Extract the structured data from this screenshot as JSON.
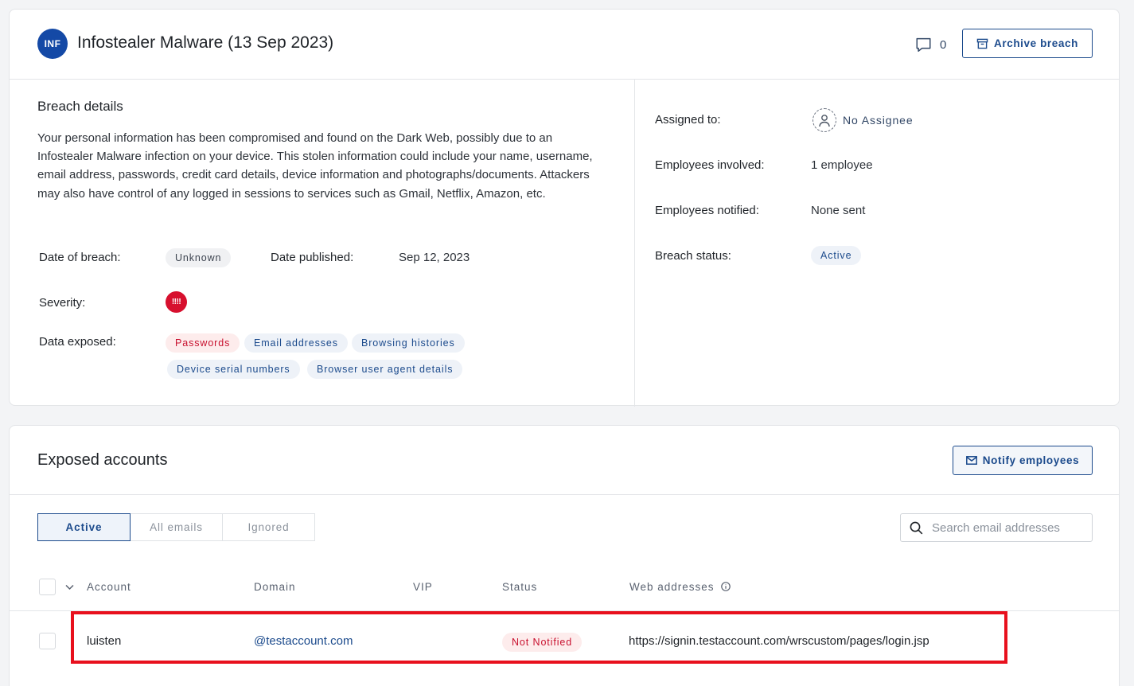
{
  "breach": {
    "avatar_initials": "INF",
    "title": "Infostealer Malware (13 Sep 2023)",
    "comment_count": "0",
    "archive_label": "Archive breach"
  },
  "details": {
    "section_title": "Breach details",
    "description": "Your personal information has been compromised and found on the Dark Web, possibly due to an Infostealer Malware infection on your device. This stolen information could include your name, username, email address, passwords, credit card details, device information and photographs/documents. Attackers may also have control of any logged in sessions to services such as Gmail, Netflix, Amazon, etc.",
    "date_of_breach_label": "Date of breach:",
    "date_of_breach_value": "Unknown",
    "date_published_label": "Date published:",
    "date_published_value": "Sep 12, 2023",
    "severity_label": "Severity:",
    "severity_value": "!!!!",
    "data_exposed_label": "Data exposed:",
    "data_exposed": [
      "Passwords",
      "Email addresses",
      "Browsing histories",
      "Device serial numbers",
      "Browser user agent details"
    ]
  },
  "meta": {
    "assigned_label": "Assigned to:",
    "assigned_value": "No Assignee",
    "employees_involved_label": "Employees involved:",
    "employees_involved_value": "1 employee",
    "employees_notified_label": "Employees notified:",
    "employees_notified_value": "None sent",
    "status_label": "Breach status:",
    "status_value": "Active"
  },
  "exposed": {
    "title": "Exposed accounts",
    "notify_label": "Notify employees",
    "tabs": [
      "Active",
      "All emails",
      "Ignored"
    ],
    "search_placeholder": "Search email addresses",
    "columns": [
      "Account",
      "Domain",
      "VIP",
      "Status",
      "Web addresses"
    ],
    "rows": [
      {
        "account": "luisten",
        "domain": "@testaccount.com",
        "vip": "",
        "status": "Not Notified",
        "web": "https://signin.testaccount.com/wrscustom/pages/login.jsp"
      }
    ]
  },
  "colors": {
    "accent": "#1b4a8c",
    "avatar": "#1449a6",
    "severity": "#d7102e",
    "highlight": "#e8101d"
  }
}
